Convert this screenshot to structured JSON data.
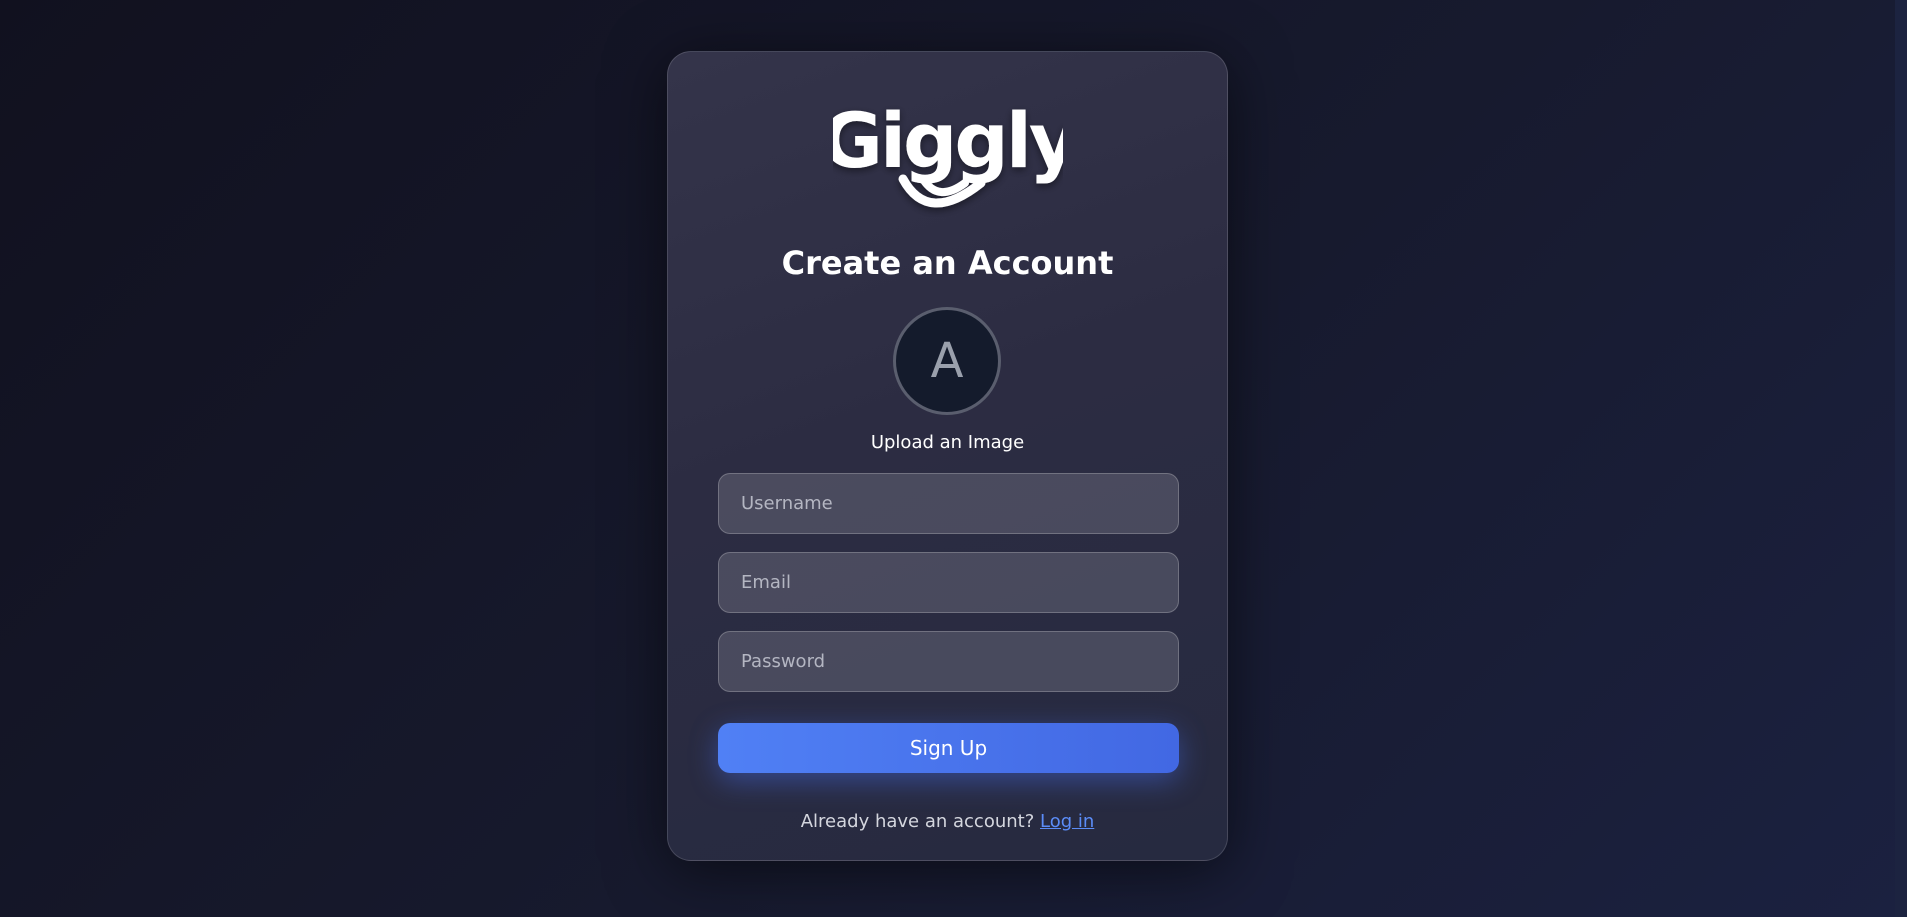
{
  "brand": {
    "name": "Giggly"
  },
  "form": {
    "title": "Create an Account",
    "avatar_initial": "A",
    "upload_label": "Upload an Image",
    "username_placeholder": "Username",
    "email_placeholder": "Email",
    "password_placeholder": "Password",
    "submit_label": "Sign Up"
  },
  "footer": {
    "prompt": "Already have an account?",
    "login_label": "Log in"
  },
  "colors": {
    "background": "#151829",
    "card": "#2e2e44",
    "accent": "#4f7ff3",
    "link": "#5b8cf7",
    "text": "#ffffff"
  },
  "icons": {
    "logo": "giggly-smile-logo"
  }
}
